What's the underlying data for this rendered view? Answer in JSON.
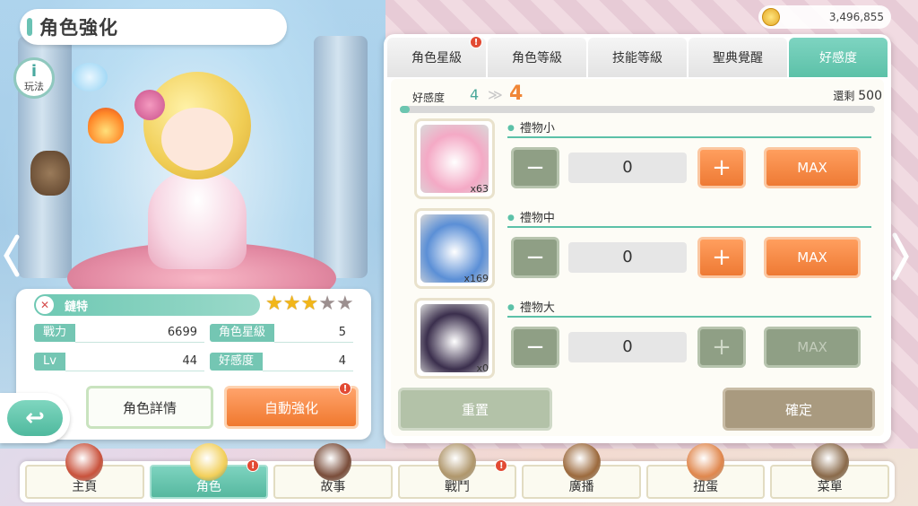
{
  "header": {
    "title": "角色強化",
    "gold": "3,496,855"
  },
  "help": {
    "icon": "i",
    "label": "玩法"
  },
  "character": {
    "name": "鏈特",
    "class_icon": "sword-icon",
    "stars_on": 3,
    "stars_total": 5,
    "stats": [
      {
        "label": "戰力",
        "value": "6699"
      },
      {
        "label": "角色星級",
        "value": "5"
      },
      {
        "label": "Lv",
        "value": "44"
      },
      {
        "label": "好感度",
        "value": "4"
      }
    ],
    "detail_label": "角色詳情",
    "auto_label": "自動強化",
    "badge": "!"
  },
  "tabs": [
    {
      "label": "角色星級",
      "badge": "!"
    },
    {
      "label": "角色等級",
      "badge": ""
    },
    {
      "label": "技能等級",
      "badge": ""
    },
    {
      "label": "聖典覺醒",
      "badge": ""
    },
    {
      "label": "好感度",
      "badge": "",
      "active": true
    }
  ],
  "affinity": {
    "label": "好感度",
    "current": "4",
    "arrow": "≫",
    "next": "4",
    "remaining_label": "還剩",
    "remaining": "500",
    "progress": 0.02
  },
  "gifts": [
    {
      "name": "禮物小",
      "count": "x63",
      "qty": "0",
      "minus": "−",
      "plus": "+",
      "max": "MAX",
      "enabled": true,
      "color": "#f4a9c5"
    },
    {
      "name": "禮物中",
      "count": "x169",
      "qty": "0",
      "minus": "−",
      "plus": "+",
      "max": "MAX",
      "enabled": true,
      "color": "#5b8fd6"
    },
    {
      "name": "禮物大",
      "count": "x0",
      "qty": "0",
      "minus": "−",
      "plus": "+",
      "max": "MAX",
      "enabled": false,
      "color": "#3b2f4d"
    }
  ],
  "actions": {
    "reset": "重置",
    "confirm": "確定"
  },
  "nav": [
    {
      "label": "主頁",
      "icon": "castle-icon",
      "badge": ""
    },
    {
      "label": "角色",
      "icon": "character-icon",
      "badge": "!",
      "active": true
    },
    {
      "label": "故事",
      "icon": "book-icon",
      "badge": ""
    },
    {
      "label": "戰鬥",
      "icon": "sword-icon",
      "badge": "!"
    },
    {
      "label": "廣播",
      "icon": "radio-icon",
      "badge": ""
    },
    {
      "label": "扭蛋",
      "icon": "gacha-icon",
      "badge": ""
    },
    {
      "label": "菜單",
      "icon": "gear-icon",
      "badge": ""
    }
  ],
  "colors": {
    "accent": "#5cc1a8",
    "orange": "#f0792e",
    "disabled": "#8f9f85"
  }
}
